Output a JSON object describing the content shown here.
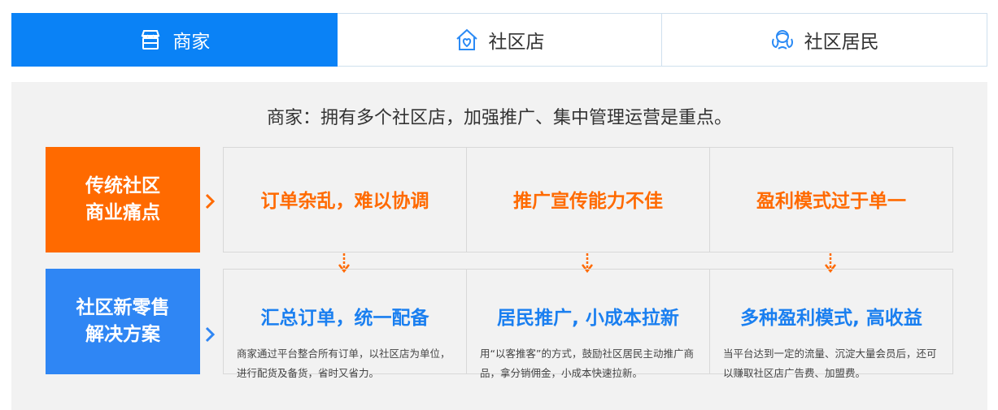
{
  "tabs": [
    {
      "label": "商家",
      "icon": "store-icon",
      "active": true
    },
    {
      "label": "社区店",
      "icon": "home-heart-icon",
      "active": false
    },
    {
      "label": "社区居民",
      "icon": "residents-icon",
      "active": false
    }
  ],
  "panel": {
    "headline": "商家：拥有多个社区店，加强推广、集中管理运营是重点。",
    "pain_label": "传统社区\n商业痛点",
    "solution_label": "社区新零售\n解决方案",
    "pain_points": [
      "订单杂乱，难以协调",
      "推广宣传能力不佳",
      "盈利模式过于单一"
    ],
    "solutions": [
      {
        "title": "汇总订单，统一配备",
        "desc": "商家通过平台整合所有订单，以社区店为单位，进行配货及备货，省时又省力。"
      },
      {
        "title": "居民推广, 小成本拉新",
        "desc": "用“以客推客”的方式，鼓励社区居民主动推广商品，拿分销佣金，小成本快速拉新。"
      },
      {
        "title": "多种盈利模式, 高收益",
        "desc": "当平台达到一定的流量、沉淀大量会员后，还可以赚取社区店广告费、加盟费。"
      }
    ]
  },
  "colors": {
    "accent_blue": "#0a82f6",
    "accent_orange": "#ff6a00",
    "solution_blue": "#2f86f4"
  }
}
